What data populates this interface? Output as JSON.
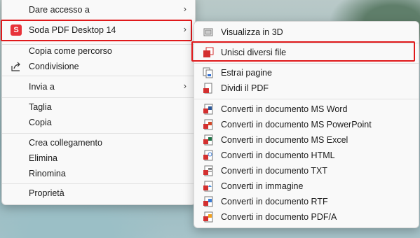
{
  "main_menu": {
    "items": [
      {
        "label": "Dare accesso a",
        "submenu": true
      },
      {
        "label": "Soda PDF Desktop 14",
        "submenu": true,
        "icon_text": "S"
      },
      {
        "label": "Copia come percorso"
      },
      {
        "label": "Condivisione"
      },
      {
        "label": "Invia a",
        "submenu": true
      },
      {
        "label": "Taglia"
      },
      {
        "label": "Copia"
      },
      {
        "label": "Crea collegamento"
      },
      {
        "label": "Elimina"
      },
      {
        "label": "Rinomina"
      },
      {
        "label": "Proprietà"
      }
    ]
  },
  "sub_menu": {
    "items": [
      {
        "label": "Visualizza in 3D",
        "icon": "cube-icon"
      },
      {
        "label": "Unisci diversi file",
        "icon": "merge-pdf-icon"
      },
      {
        "label": "Estrai pagine",
        "icon": "extract-pages-icon"
      },
      {
        "label": "Dividi il PDF",
        "icon": "split-pdf-icon"
      },
      {
        "label": "Converti in documento MS Word",
        "icon": "word-doc-icon"
      },
      {
        "label": "Converti in documento MS PowerPoint",
        "icon": "powerpoint-doc-icon"
      },
      {
        "label": "Converti in documento MS Excel",
        "icon": "excel-doc-icon"
      },
      {
        "label": "Converti in documento HTML",
        "icon": "html-doc-icon"
      },
      {
        "label": "Converti in documento TXT",
        "icon": "txt-doc-icon"
      },
      {
        "label": "Converti in immagine",
        "icon": "image-doc-icon"
      },
      {
        "label": "Converti in documento RTF",
        "icon": "rtf-doc-icon"
      },
      {
        "label": "Converti in documento PDF/A",
        "icon": "pdfa-doc-icon"
      }
    ]
  },
  "arrow_glyph": "›",
  "colors": {
    "highlight": "#e0191b",
    "soda_brand": "#e8333a",
    "menu_bg": "#f9f9f9"
  }
}
